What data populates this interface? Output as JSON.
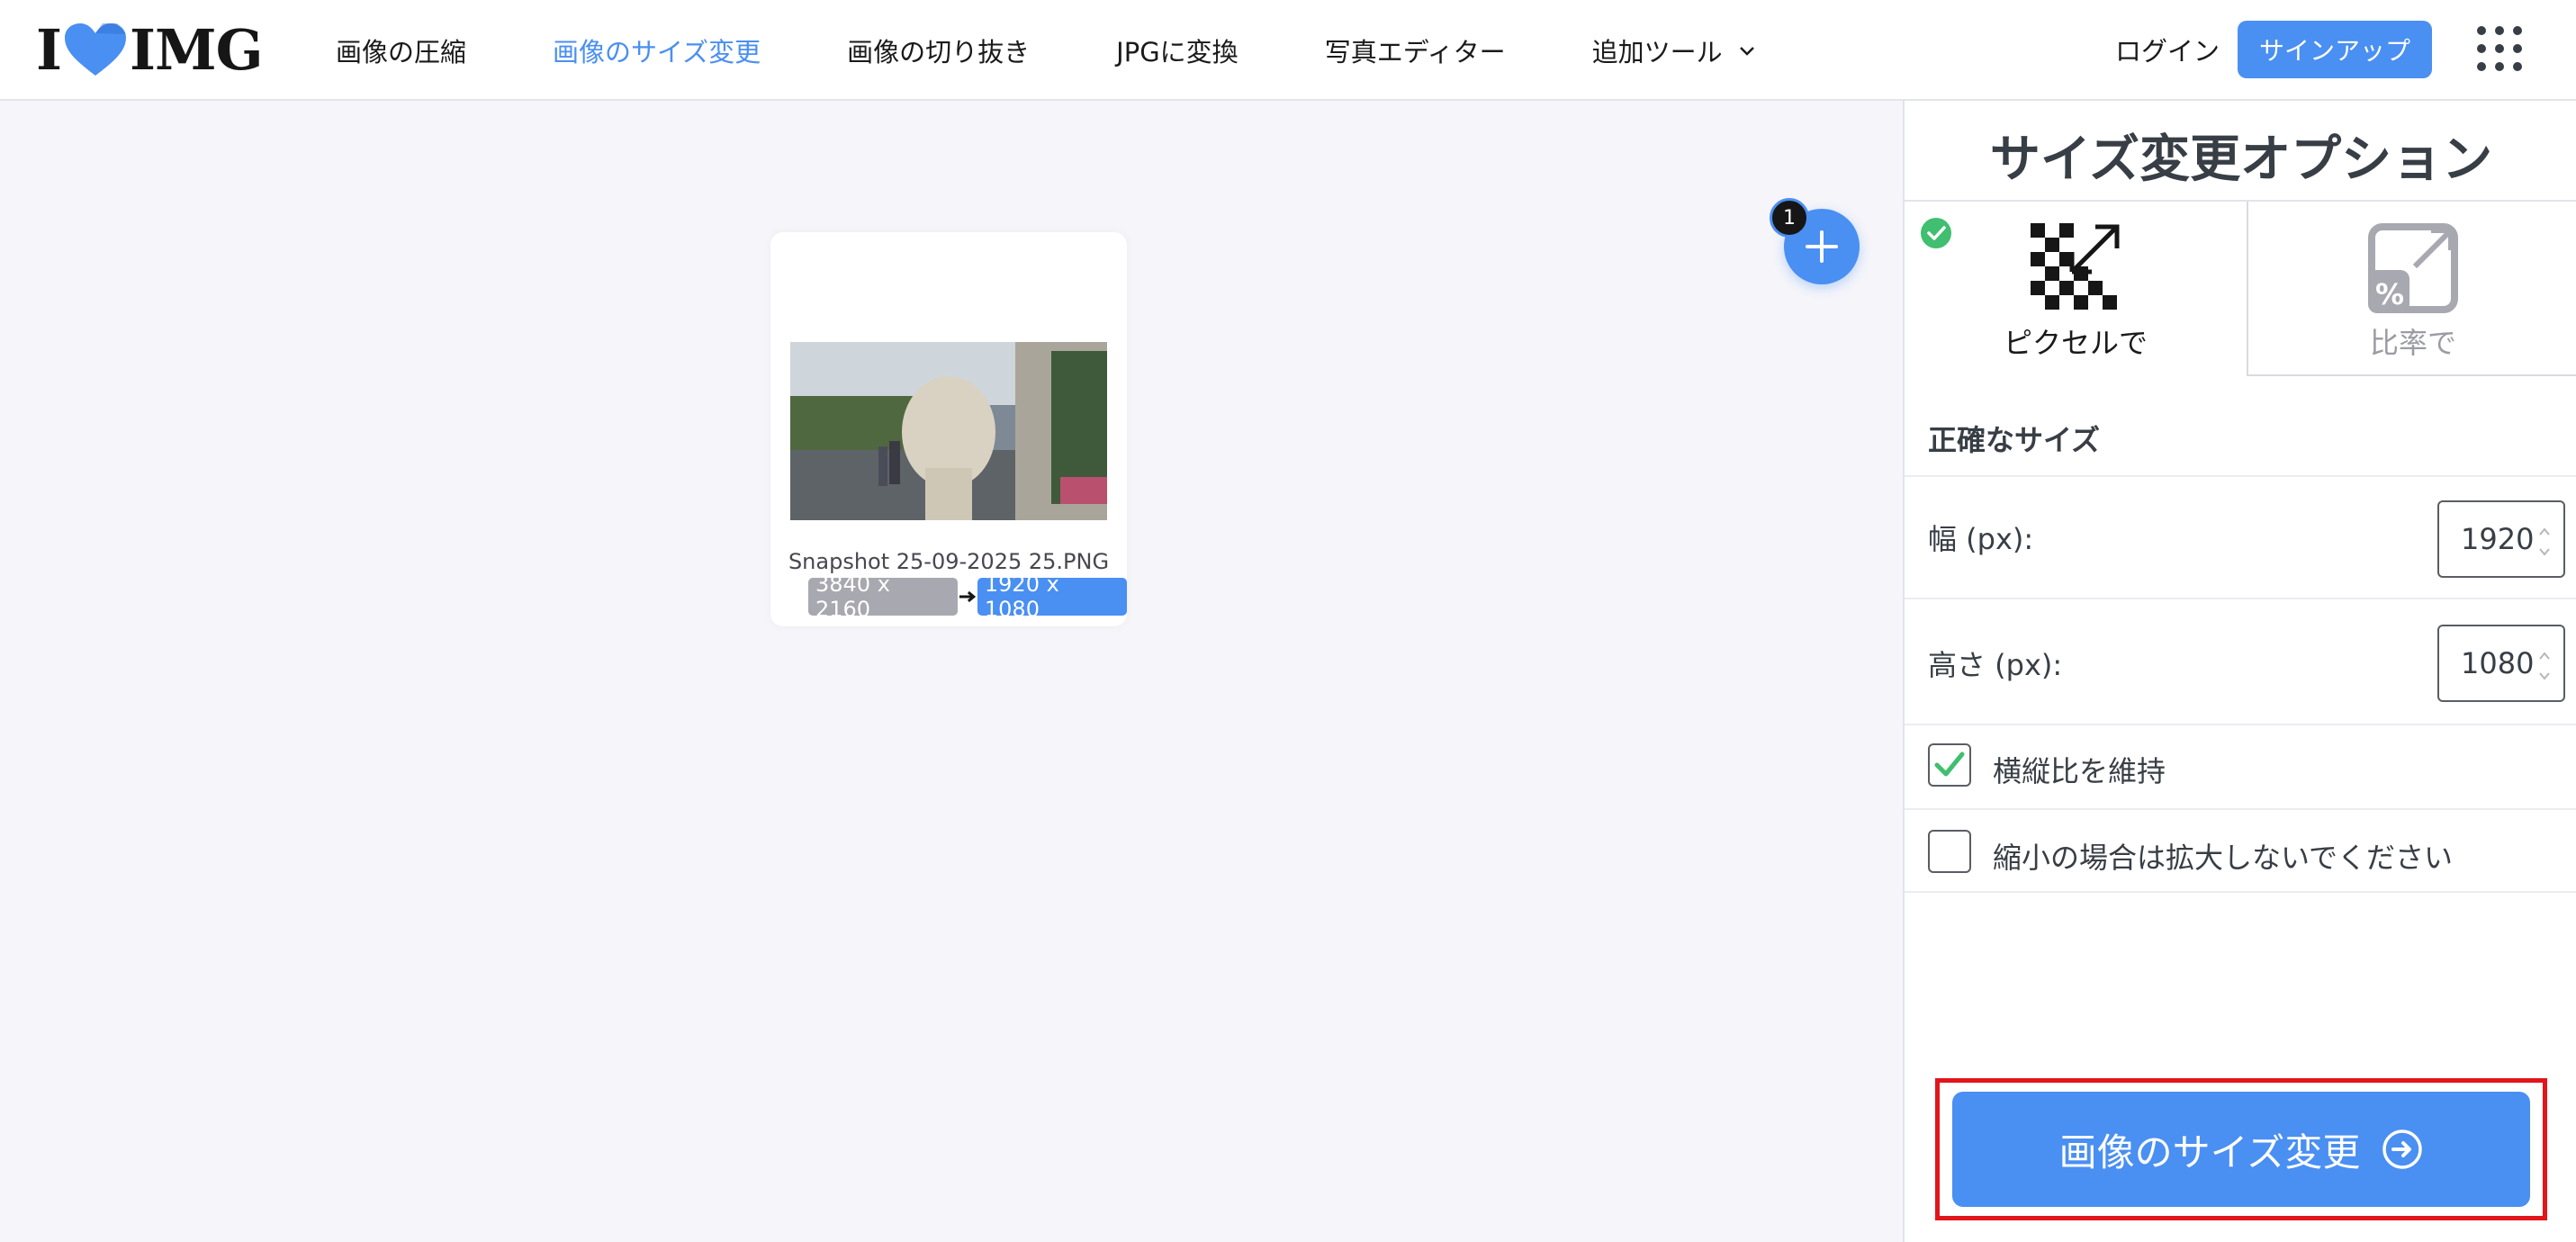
{
  "brand": {
    "logo_left": "I",
    "logo_right": "IMG",
    "accent": "#4a8ff2"
  },
  "nav": {
    "items": [
      {
        "label": "画像の圧縮"
      },
      {
        "label": "画像のサイズ変更"
      },
      {
        "label": "画像の切り抜き"
      },
      {
        "label": "JPGに変換"
      },
      {
        "label": "写真エディター"
      },
      {
        "label": "追加ツール"
      }
    ],
    "login": "ログイン",
    "signup": "サインアップ"
  },
  "workspace": {
    "file": {
      "name": "Snapshot 25-09-2025 25.PNG",
      "original_size": "3840 x 2160",
      "new_size": "1920 x 1080"
    },
    "file_count": "1"
  },
  "sidebar": {
    "title": "サイズ変更オプション",
    "modes": [
      {
        "label": "ピクセルで"
      },
      {
        "label": "比率で"
      }
    ],
    "exact_size_title": "正確なサイズ",
    "width_label": "幅 (px):",
    "width_value": "1920",
    "height_label": "高さ (px):",
    "height_value": "1080",
    "keep_ratio_label": "横縦比を維持",
    "no_enlarge_label": "縮小の場合は拡大しないでください",
    "resize_button": "画像のサイズ変更"
  }
}
